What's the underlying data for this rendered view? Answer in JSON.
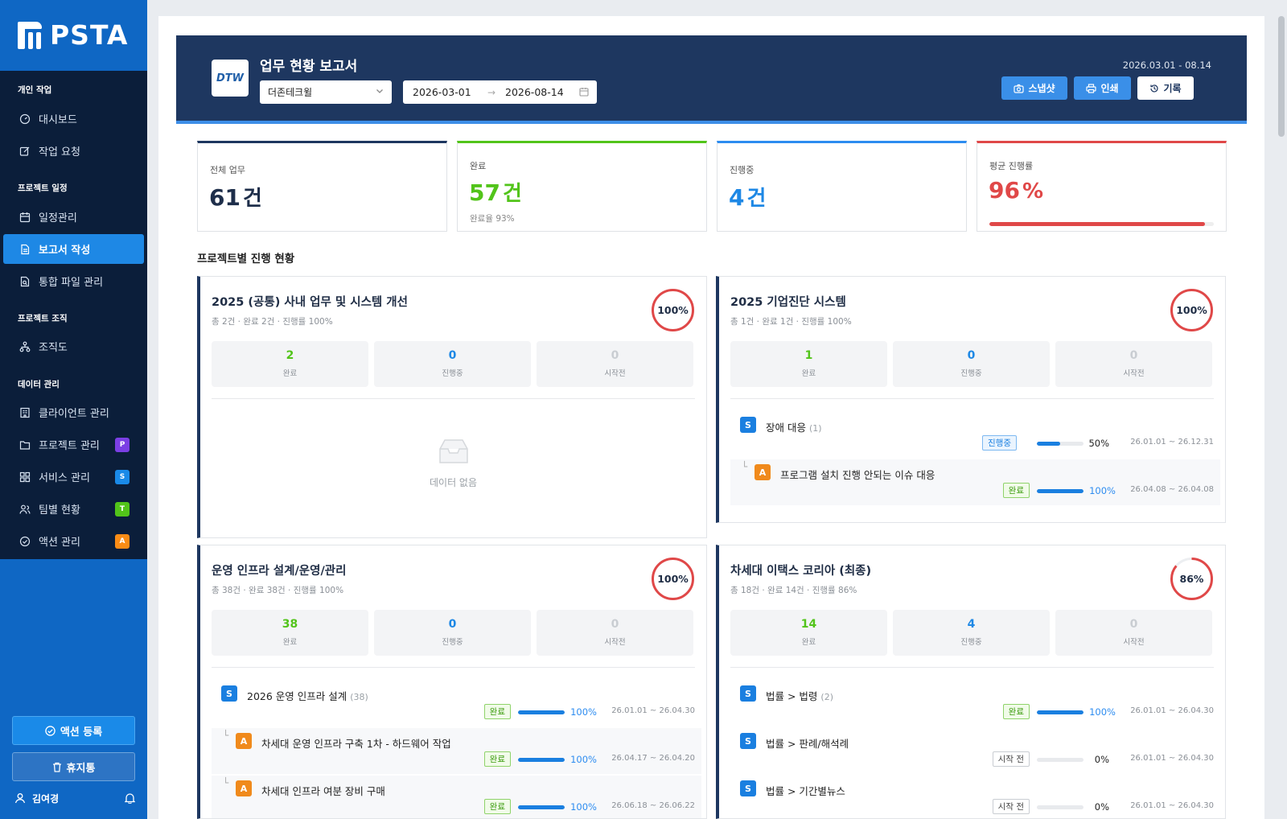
{
  "app": {
    "brand": "PSTA"
  },
  "sidebar": {
    "sections": [
      {
        "label": "개인 작업",
        "items": [
          {
            "label": "대시보드",
            "icon": "dashboard-icon"
          },
          {
            "label": "작업 요청",
            "icon": "edit-icon"
          }
        ]
      },
      {
        "label": "프로젝트 일정",
        "items": [
          {
            "label": "일정관리",
            "icon": "calendar-icon"
          },
          {
            "label": "보고서 작성",
            "icon": "document-icon",
            "active": true
          },
          {
            "label": "통합 파일 관리",
            "icon": "file-search-icon"
          }
        ]
      },
      {
        "label": "프로젝트 조직",
        "items": [
          {
            "label": "조직도",
            "icon": "org-chart-icon"
          }
        ]
      },
      {
        "label": "데이터 관리",
        "items": [
          {
            "label": "클라이언트 관리",
            "icon": "building-icon"
          },
          {
            "label": "프로젝트 관리",
            "icon": "folder-icon",
            "badge": "P",
            "badge_color": "#7b3fe4"
          },
          {
            "label": "서비스 관리",
            "icon": "grid-icon",
            "badge": "S",
            "badge_color": "#1a8ae8"
          },
          {
            "label": "팀별 현황",
            "icon": "team-icon",
            "badge": "T",
            "badge_color": "#52c41a"
          },
          {
            "label": "액션 관리",
            "icon": "check-circle-icon",
            "badge": "A",
            "badge_color": "#fa8c16"
          }
        ]
      }
    ],
    "action_button": "액션 등록",
    "trash_button": "휴지통",
    "user": "김여경"
  },
  "header": {
    "logo_text": "DTW",
    "title": "업무 현황 보고서",
    "client_select": "더존테크윌",
    "date_from": "2026-03-01",
    "date_to": "2026-08-14",
    "date_arrow": "→",
    "range_display": "2026.03.01 - 08.14",
    "buttons": {
      "snapshot": "스냅샷",
      "print": "인쇄",
      "history": "기록"
    }
  },
  "stats": [
    {
      "label": "전체 업무",
      "value": "61",
      "unit": "건",
      "color": "#1e2e4a",
      "top_color": "#1e3760"
    },
    {
      "label": "완료",
      "value": "57",
      "unit": "건",
      "color": "#52c41a",
      "top_color": "#52c41a",
      "sub": "완료율 93%"
    },
    {
      "label": "진행중",
      "value": "4",
      "unit": "건",
      "color": "#1e88e5",
      "top_color": "#2d8cf0"
    },
    {
      "label": "평균 진행률",
      "value": "96",
      "unit": "%",
      "color": "#e04848",
      "top_color": "#e04848",
      "progress": 0.96
    }
  ],
  "section_title": "프로젝트별 진행 현황",
  "projects": [
    {
      "title": "2025 (공통) 사내 업무 및 시스템 개선",
      "summary": "총 2건 · 완료 2건 · 진행률 100%",
      "percent_label": "100%",
      "percent": 1.0,
      "counts": [
        {
          "n": "2",
          "label": "완료"
        },
        {
          "n": "0",
          "label": "진행중"
        },
        {
          "n": "0",
          "label": "시작전"
        }
      ],
      "empty_text": "데이터 없음",
      "tasks": []
    },
    {
      "title": "2025 기업진단 시스템",
      "summary": "총 1건 · 완료 1건 · 진행률 100%",
      "percent_label": "100%",
      "percent": 1.0,
      "counts": [
        {
          "n": "1",
          "label": "완료"
        },
        {
          "n": "0",
          "label": "진행중"
        },
        {
          "n": "0",
          "label": "시작전"
        }
      ],
      "tasks": [
        {
          "type": "S",
          "name": "장애 대응",
          "count": "(1)",
          "status": "진행중",
          "status_kind": "prog",
          "progress": 0.5,
          "pct": "50%",
          "dates": "26.01.01 ~ 26.12.31"
        },
        {
          "type": "A",
          "sub": true,
          "name": "프로그램 설치 진행 안되는 이슈 대응",
          "status": "완료",
          "status_kind": "done",
          "progress": 1.0,
          "pct": "100%",
          "dates": "26.04.08 ~ 26.04.08"
        }
      ]
    },
    {
      "title": "운영 인프라 설계/운영/관리",
      "summary": "총 38건 · 완료 38건 · 진행률 100%",
      "percent_label": "100%",
      "percent": 1.0,
      "counts": [
        {
          "n": "38",
          "label": "완료"
        },
        {
          "n": "0",
          "label": "진행중"
        },
        {
          "n": "0",
          "label": "시작전"
        }
      ],
      "tasks": [
        {
          "type": "S",
          "name": "2026 운영 인프라 설계",
          "count": "(38)",
          "status": "완료",
          "status_kind": "done",
          "progress": 1.0,
          "pct": "100%",
          "dates": "26.01.01 ~ 26.04.30"
        },
        {
          "type": "A",
          "sub": true,
          "name": "차세대 운영 인프라 구축 1차 - 하드웨어 작업",
          "status": "완료",
          "status_kind": "done",
          "progress": 1.0,
          "pct": "100%",
          "dates": "26.04.17 ~ 26.04.20"
        },
        {
          "type": "A",
          "sub": true,
          "name": "차세대 인프라 여분 장비 구매",
          "status": "완료",
          "status_kind": "done",
          "progress": 1.0,
          "pct": "100%",
          "dates": "26.06.18 ~ 26.06.22"
        }
      ]
    },
    {
      "title": "차세대 이택스 코리아 (최종)",
      "summary": "총 18건 · 완료 14건 · 진행률 86%",
      "percent_label": "86%",
      "percent": 0.86,
      "counts": [
        {
          "n": "14",
          "label": "완료"
        },
        {
          "n": "4",
          "label": "진행중"
        },
        {
          "n": "0",
          "label": "시작전"
        }
      ],
      "tasks": [
        {
          "type": "S",
          "name": "법률 > 법령",
          "count": "(2)",
          "status": "완료",
          "status_kind": "done",
          "progress": 1.0,
          "pct": "100%",
          "dates": "26.01.01 ~ 26.04.30"
        },
        {
          "type": "S",
          "name": "법률 > 판례/해석례",
          "status": "시작 전",
          "status_kind": "todo",
          "progress": 0,
          "pct": "0%",
          "dates": "26.01.01 ~ 26.04.30"
        },
        {
          "type": "S",
          "name": "법률 > 기간별뉴스",
          "status": "시작 전",
          "status_kind": "todo",
          "progress": 0,
          "pct": "0%",
          "dates": "26.01.01 ~ 26.04.30"
        }
      ]
    }
  ]
}
